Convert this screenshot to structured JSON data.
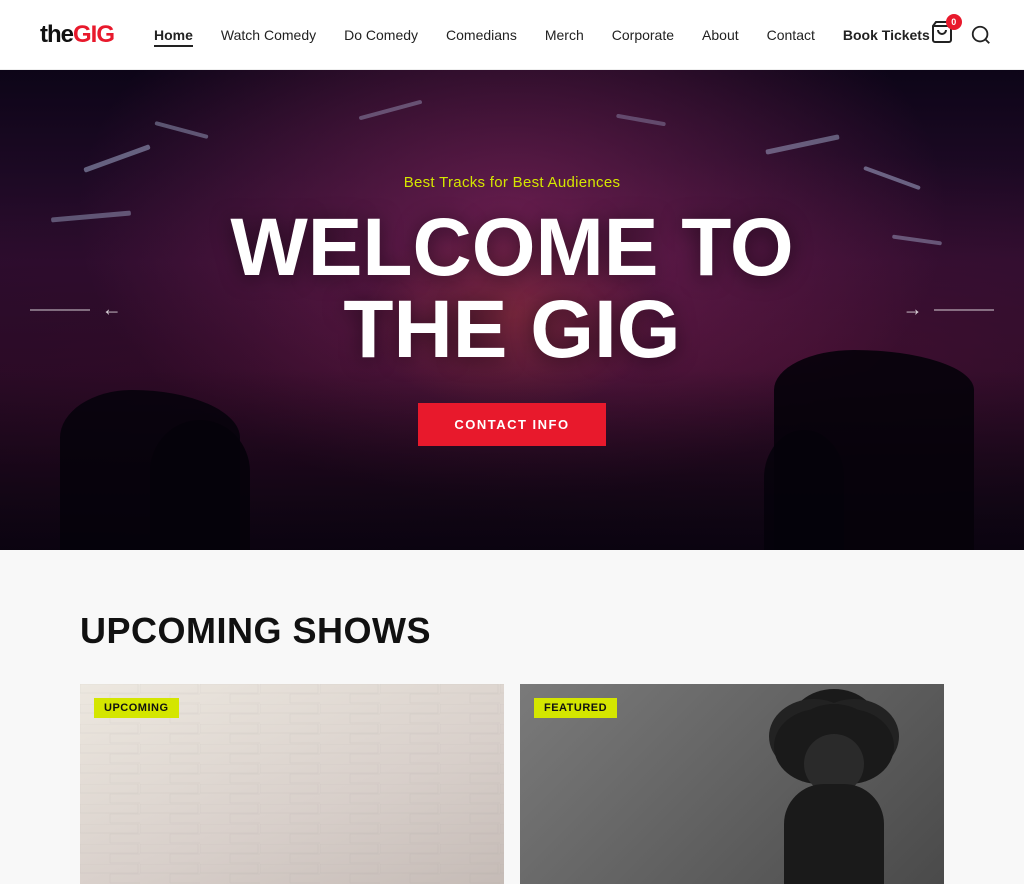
{
  "site": {
    "logo_the": "the",
    "logo_gig": "GIG"
  },
  "nav": {
    "items": [
      {
        "label": "Home",
        "active": true
      },
      {
        "label": "Watch Comedy",
        "active": false
      },
      {
        "label": "Do Comedy",
        "active": false
      },
      {
        "label": "Comedians",
        "active": false
      },
      {
        "label": "Merch",
        "active": false
      },
      {
        "label": "Corporate",
        "active": false
      },
      {
        "label": "About",
        "active": false
      },
      {
        "label": "Contact",
        "active": false
      },
      {
        "label": "Book Tickets",
        "active": false
      }
    ],
    "cart_count": "0"
  },
  "hero": {
    "subtitle": "Best Tracks for Best Audiences",
    "title_line1": "WELCOME TO",
    "title_line2": "THE GIG",
    "cta_label": "CONTACT INFO",
    "arrow_left": "←",
    "arrow_right": "→"
  },
  "upcoming": {
    "section_title": "UPCOMING SHOWS",
    "cards": [
      {
        "badge": "UPCOMING",
        "badge_type": "upcoming"
      },
      {
        "badge": "FEATURED",
        "badge_type": "featured"
      }
    ]
  }
}
